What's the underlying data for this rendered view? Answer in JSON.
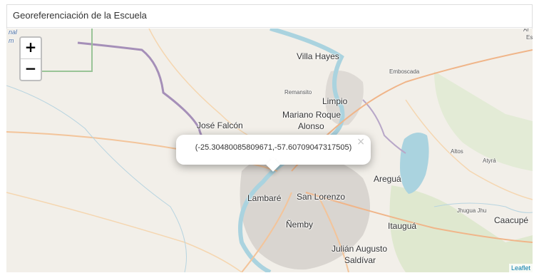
{
  "panel": {
    "title": "Georeferenciación de la Escuela"
  },
  "map": {
    "zoom_in": "+",
    "zoom_out": "−",
    "popup": {
      "text": "(-25.30480085809671,-57.60709047317505)",
      "close": "×"
    },
    "attribution": "Leaflet",
    "places": {
      "villa_hayes": "Villa Hayes",
      "emboscada": "Emboscada",
      "remansito": "Remansito",
      "limpio": "Limpio",
      "mariano_roque_alonso_1": "Mariano Roque",
      "mariano_roque_alonso_2": "Alonso",
      "jose_falcon": "José Falcón",
      "aregua": "Areguá",
      "altos": "Altos",
      "atyra": "Atyrá",
      "lambare": "Lambaré",
      "san_lorenzo": "San Lorenzo",
      "nemby": "Ñemby",
      "itaugua": "Itauguá",
      "jhugua_jhu": "Jhugua Jhu",
      "caacupe": "Caacupé",
      "julian_augusto_1": "Julián Augusto",
      "julian_augusto_2": "Saldívar",
      "edge_left_1": "nal",
      "edge_left_2": "m",
      "edge_right_1": "Ar",
      "edge_right_2": "Es"
    }
  }
}
